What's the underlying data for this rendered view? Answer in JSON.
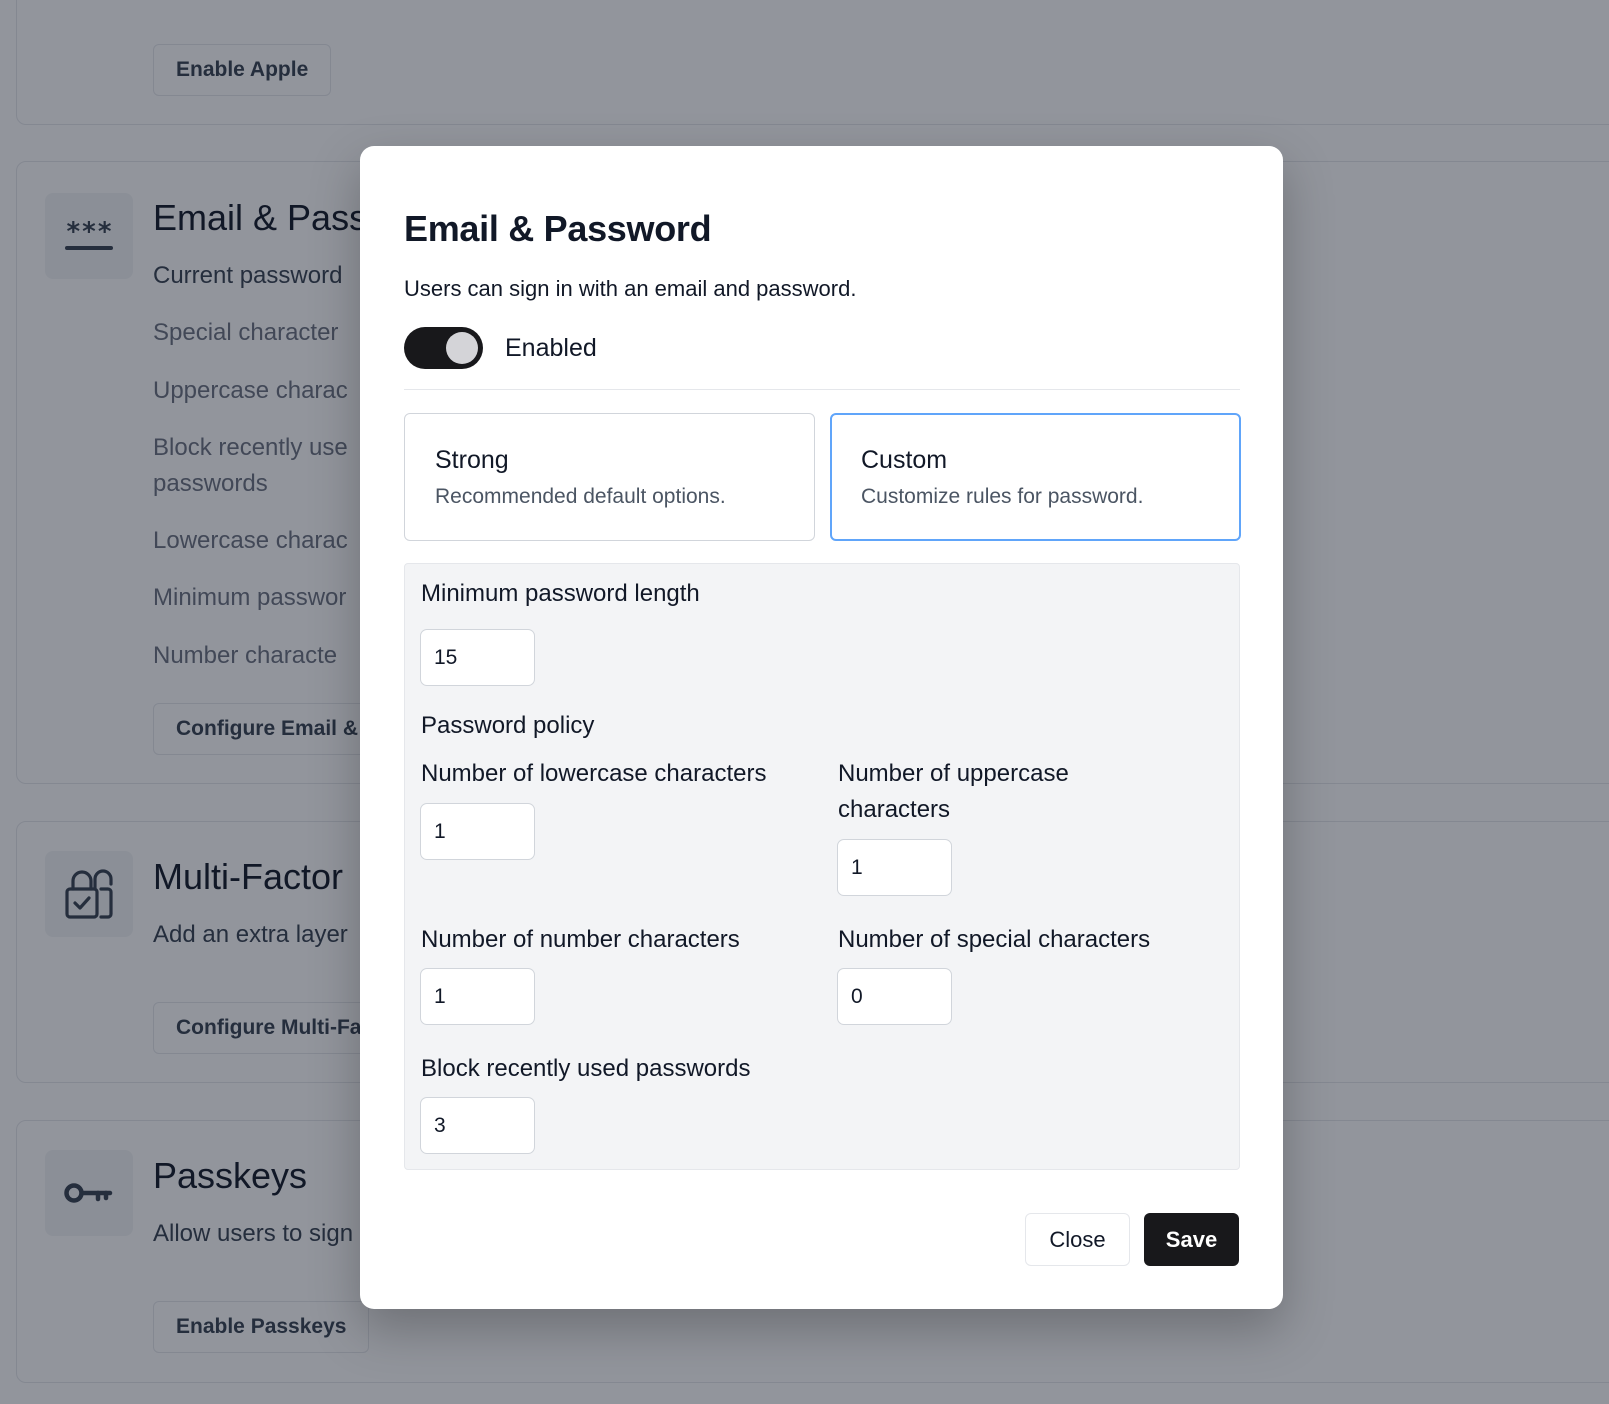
{
  "background": {
    "apple_section": {
      "button_label": "Enable Apple"
    },
    "email_section": {
      "title": "Email & Passw",
      "lines": [
        "Current password",
        "Special character",
        "Uppercase charac",
        "Block recently use",
        "passwords",
        "Lowercase charac",
        "Minimum passwor",
        "Number characte"
      ],
      "button_label": "Configure Email &"
    },
    "mfa_section": {
      "title": "Multi-Factor",
      "description": "Add an extra layer",
      "button_label": "Configure Multi-Fa"
    },
    "passkeys_section": {
      "title": "Passkeys",
      "description": "Allow users to sign",
      "button_label": "Enable Passkeys"
    }
  },
  "modal": {
    "title": "Email & Password",
    "description": "Users can sign in with an email and password.",
    "toggle": {
      "label": "Enabled",
      "on": true
    },
    "options": [
      {
        "title": "Strong",
        "subtitle": "Recommended default options.",
        "selected": false
      },
      {
        "title": "Custom",
        "subtitle": "Customize rules for password.",
        "selected": true
      }
    ],
    "rules": {
      "min_length_label": "Minimum password length",
      "min_length_value": "15",
      "policy_heading": "Password policy",
      "lowercase_label": "Number of lowercase characters",
      "lowercase_value": "1",
      "uppercase_label_line1": "Number of uppercase",
      "uppercase_label_line2": "characters",
      "uppercase_value": "1",
      "number_label": "Number of number characters",
      "number_value": "1",
      "special_label": "Number of special characters",
      "special_value": "0",
      "block_recent_label": "Block recently used passwords",
      "block_recent_value": "3"
    },
    "close_label": "Close",
    "save_label": "Save"
  },
  "colors": {
    "overlay": "#111827",
    "selected_border": "#60a5fa",
    "primary_button": "#18181b"
  }
}
